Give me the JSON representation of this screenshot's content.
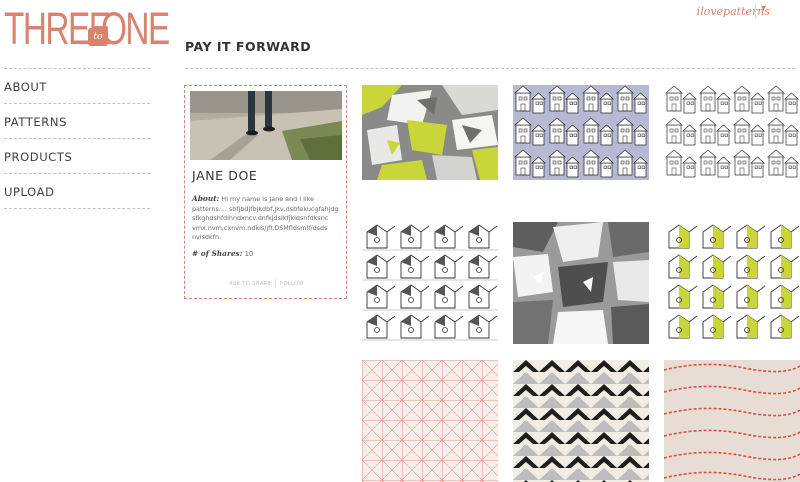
{
  "logo": {
    "left": "THREE",
    "badge": "to",
    "right": "ONE"
  },
  "user_menu": {
    "username": "ilovepatterns",
    "caret": "▾"
  },
  "nav": {
    "items": [
      {
        "label": "ABOUT"
      },
      {
        "label": "PATTERNS"
      },
      {
        "label": "PRODUCTS"
      },
      {
        "label": "UPLOAD"
      }
    ]
  },
  "page": {
    "title": "PAY IT FORWARD"
  },
  "profile": {
    "name": "JANE DOE",
    "about_label": "About:",
    "about_text": "Hi my name is Jane and I like patterns.... sbfjbdjfbjkdbf,jkv,dsbfekucgfahjdg sfkghdshfdihndxncv.dnfkjdslkfjkldsnfdksnc vmx.nvm,cxnvm.ndkls/jfl;DSMfldsmlf/dsds nvlsdkfn.",
    "shares_label": "# of Shares:",
    "shares_count": "10",
    "action_ask": "ASK TO SHARE",
    "action_follow": "FOLLOW"
  },
  "patterns": [
    {
      "name": "lime-gray-floral"
    },
    {
      "name": "lavender-houses"
    },
    {
      "name": "white-houses"
    },
    {
      "name": "bw-birdhouses"
    },
    {
      "name": "gray-geometric-floral"
    },
    {
      "name": "lime-birdhouses"
    },
    {
      "name": "coral-grid-lines"
    },
    {
      "name": "bw-triangles"
    },
    {
      "name": "red-stitch-linen"
    }
  ],
  "colors": {
    "accent": "#d9826d",
    "lime": "#c9d63a",
    "text": "#3a3a3a",
    "rule": "#c4c4c4"
  }
}
